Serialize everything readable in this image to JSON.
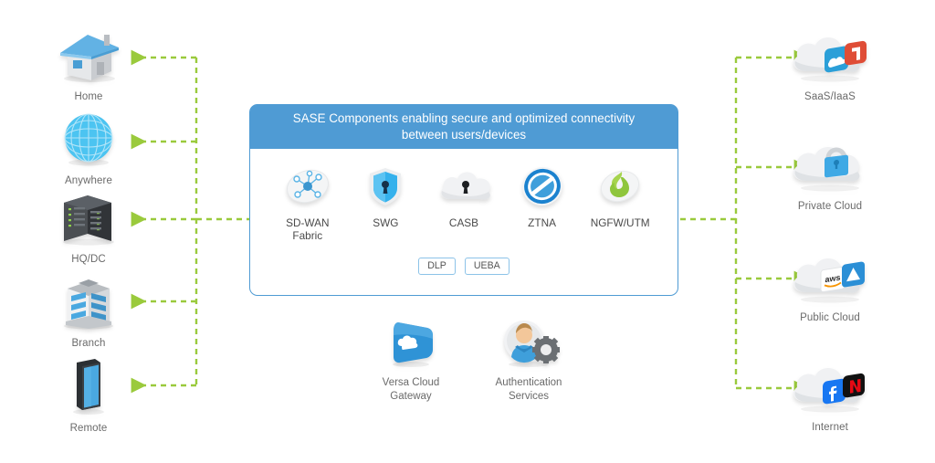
{
  "panel": {
    "title": "SASE Components enabling secure and optimized connectivity between users/devices",
    "title_line1": "SASE Components enabling secure and optimized connectivity",
    "title_line2": "between users/devices",
    "components": [
      {
        "label_line1": "SD-WAN",
        "label_line2": "Fabric",
        "icon": "sd-wan-mesh-icon"
      },
      {
        "label_line1": "SWG",
        "label_line2": "",
        "icon": "shield-keyhole-icon"
      },
      {
        "label_line1": "CASB",
        "label_line2": "",
        "icon": "cloud-keyhole-icon"
      },
      {
        "label_line1": "ZTNA",
        "label_line2": "",
        "icon": "no-entry-icon"
      },
      {
        "label_line1": "NGFW/UTM",
        "label_line2": "",
        "icon": "flame-icon"
      }
    ],
    "badges": [
      "DLP",
      "UEBA"
    ]
  },
  "left_nodes": [
    {
      "label": "Home",
      "icon": "house-icon"
    },
    {
      "label": "Anywhere",
      "icon": "globe-icon"
    },
    {
      "label": "HQ/DC",
      "icon": "server-rack-icon"
    },
    {
      "label": "Branch",
      "icon": "office-building-icon"
    },
    {
      "label": "Remote",
      "icon": "smartphone-icon"
    }
  ],
  "right_nodes": [
    {
      "label": "SaaS/IaaS",
      "icon": "cloud-saas-icon"
    },
    {
      "label": "Private Cloud",
      "icon": "cloud-lock-icon"
    },
    {
      "label": "Public Cloud",
      "icon": "cloud-aws-azure-icon"
    },
    {
      "label": "Internet",
      "icon": "cloud-internet-icon"
    }
  ],
  "services": [
    {
      "label_line1": "Versa Cloud",
      "label_line2": "Gateway",
      "icon": "versa-cloud-gateway-icon"
    },
    {
      "label_line1": "Authentication",
      "label_line2": "Services",
      "icon": "auth-user-gear-icon"
    }
  ],
  "colors": {
    "accent_blue": "#4f9bd4",
    "connector_green": "#9aca3c",
    "label_gray": "#6a6a6a",
    "badge_border": "#8cc3e8"
  }
}
